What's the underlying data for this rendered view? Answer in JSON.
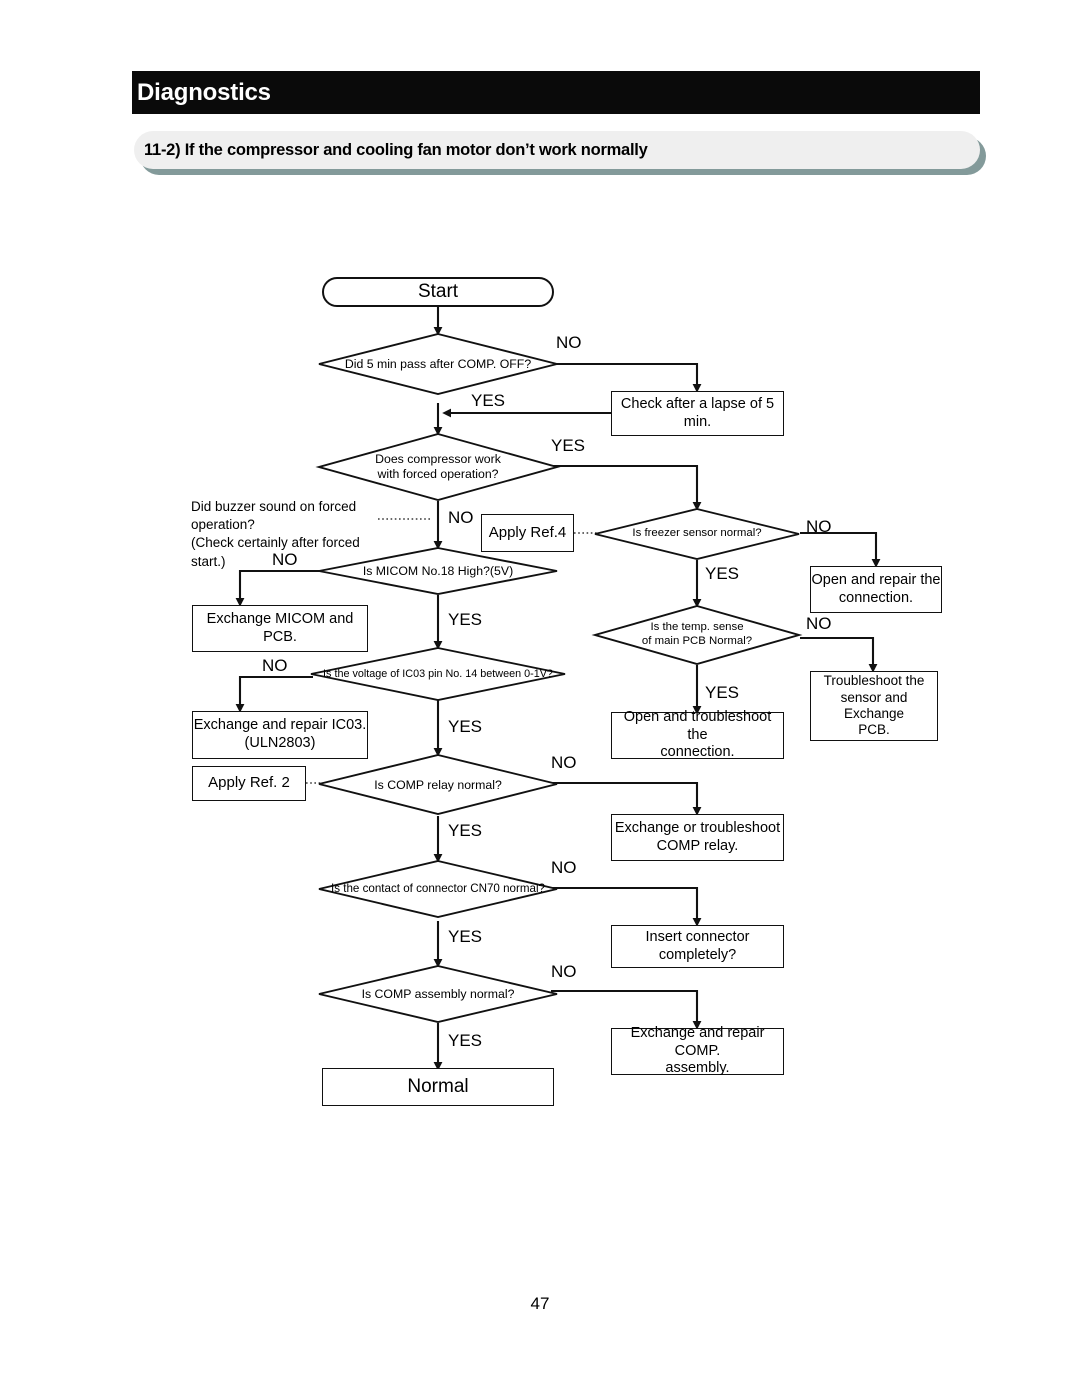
{
  "document": {
    "header_title": "Diagnostics",
    "section_title": "11-2) If the compressor and cooling fan motor don’t work normally",
    "page_number": "47",
    "colors": {
      "header_bar": "#0a0a0a",
      "header_text": "#ffffff",
      "section_band": "#efefef",
      "section_band_shadow": "#839a9a",
      "line": "#111111",
      "page_background": "#ffffff"
    }
  },
  "flowchart": {
    "type": "flowchart",
    "orientation": "top-down",
    "nodes": {
      "start": {
        "label": "Start",
        "shape": "terminator"
      },
      "d_5min": {
        "label": "Did 5 min pass after COMP. OFF?",
        "shape": "decision"
      },
      "check_lapse": {
        "label": "Check after a lapse of 5 min.",
        "shape": "process"
      },
      "d_comp_forced": {
        "label": "Does compressor work\nwith forced operation?",
        "shape": "decision"
      },
      "apply_ref4": {
        "label": "Apply Ref.4",
        "shape": "process"
      },
      "d_freezer_sensor": {
        "label": "Is freezer sensor normal?",
        "shape": "decision"
      },
      "open_repair_conn": {
        "label": "Open and repair the\nconnection.",
        "shape": "process"
      },
      "d_temp_sense": {
        "label": "Is the temp. sense\nof main PCB Normal?",
        "shape": "decision"
      },
      "troubleshoot_sensor": {
        "label": "Troubleshoot the\nsensor and Exchange\nPCB.",
        "shape": "process"
      },
      "open_troubleshoot_conn": {
        "label": "Open and troubleshoot the\nconnection.",
        "shape": "process"
      },
      "d_micom": {
        "label": "Is MICOM No.18 High?(5V)",
        "shape": "decision"
      },
      "exchange_micom": {
        "label": "Exchange MICOM and PCB.",
        "shape": "process"
      },
      "d_ic03_voltage": {
        "label": "Is the voltage of IC03 pin No. 14 between 0-1V?",
        "shape": "decision"
      },
      "exchange_ic03": {
        "label": "Exchange and repair IC03.\n(ULN2803)",
        "shape": "process"
      },
      "apply_ref2": {
        "label": "Apply Ref. 2",
        "shape": "process"
      },
      "d_comp_relay": {
        "label": "Is COMP relay normal?",
        "shape": "decision"
      },
      "exchange_relay": {
        "label": "Exchange or troubleshoot\nCOMP relay.",
        "shape": "process"
      },
      "d_cn70": {
        "label": "Is the contact of connector CN70 normal?",
        "shape": "decision"
      },
      "insert_connector": {
        "label": "Insert connector completely?",
        "shape": "process"
      },
      "d_comp_assembly": {
        "label": "Is COMP assembly normal?",
        "shape": "decision"
      },
      "exchange_comp_assy": {
        "label": "Exchange and repair COMP.\nassembly.",
        "shape": "process"
      },
      "normal": {
        "label": "Normal",
        "shape": "terminator-rect"
      }
    },
    "annotations": {
      "buzzer_note": "Did buzzer sound on forced operation?\n(Check certainly after forced start.)"
    },
    "edge_labels": {
      "no_5min": "NO",
      "yes_5min": "YES",
      "yes_comp_forced": "YES",
      "no_comp_forced": "NO",
      "no_freezer_sensor": "NO",
      "yes_freezer_sensor": "YES",
      "no_temp_sense": "NO",
      "yes_temp_sense": "YES",
      "no_micom": "NO",
      "yes_micom": "YES",
      "no_ic03": "NO",
      "yes_ic03": "YES",
      "no_relay": "NO",
      "yes_relay": "YES",
      "no_cn70": "NO",
      "yes_cn70": "YES",
      "no_assembly": "NO",
      "yes_assembly": "YES"
    },
    "edges": [
      {
        "from": "start",
        "to": "d_5min",
        "label": ""
      },
      {
        "from": "d_5min",
        "to": "check_lapse",
        "label": "NO"
      },
      {
        "from": "check_lapse",
        "to": "d_comp_forced",
        "label": "YES"
      },
      {
        "from": "d_comp_forced",
        "to": "apply_ref4",
        "label": "YES"
      },
      {
        "from": "d_comp_forced",
        "to": "d_micom",
        "label": "NO"
      },
      {
        "from": "d_freezer_sensor",
        "to": "open_repair_conn",
        "label": "NO"
      },
      {
        "from": "d_freezer_sensor",
        "to": "d_temp_sense",
        "label": "YES"
      },
      {
        "from": "d_temp_sense",
        "to": "troubleshoot_sensor",
        "label": "NO"
      },
      {
        "from": "d_temp_sense",
        "to": "open_troubleshoot_conn",
        "label": "YES"
      },
      {
        "from": "d_micom",
        "to": "exchange_micom",
        "label": "NO"
      },
      {
        "from": "d_micom",
        "to": "d_ic03_voltage",
        "label": "YES"
      },
      {
        "from": "d_ic03_voltage",
        "to": "exchange_ic03",
        "label": "NO"
      },
      {
        "from": "d_ic03_voltage",
        "to": "d_comp_relay",
        "label": "YES"
      },
      {
        "from": "d_comp_relay",
        "to": "exchange_relay",
        "label": "NO"
      },
      {
        "from": "d_comp_relay",
        "to": "d_cn70",
        "label": "YES"
      },
      {
        "from": "d_cn70",
        "to": "insert_connector",
        "label": "NO"
      },
      {
        "from": "d_cn70",
        "to": "d_comp_assembly",
        "label": "YES"
      },
      {
        "from": "d_comp_assembly",
        "to": "exchange_comp_assy",
        "label": "NO"
      },
      {
        "from": "d_comp_assembly",
        "to": "normal",
        "label": "YES"
      }
    ]
  }
}
